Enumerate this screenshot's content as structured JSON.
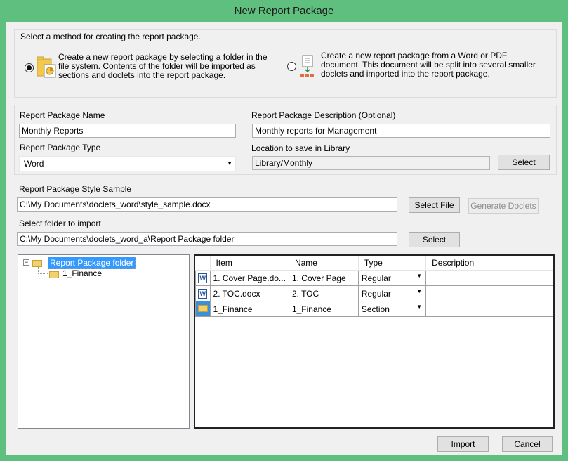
{
  "window": {
    "title": "New Report Package"
  },
  "method": {
    "legend": "Select a method for creating the report package.",
    "option_folder": "Create a new report package by selecting a folder in the file system. Contents of the folder will be imported as sections and doclets into the report package.",
    "option_document": "Create a new report package from a Word or PDF document. This document will be split into several smaller doclets and imported into the report package."
  },
  "package": {
    "name_label": "Report Package Name",
    "name_value": "Monthly Reports",
    "desc_label": "Report Package Description (Optional)",
    "desc_value": "Monthly reports for Management",
    "type_label": "Report Package Type",
    "type_value": "Word",
    "location_label": "Location to save in Library",
    "location_value": "Library/Monthly",
    "select_label": "Select"
  },
  "style": {
    "label": "Report Package Style Sample",
    "path": "C:\\My Documents\\doclets_word\\style_sample.docx",
    "select_file_label": "Select File",
    "generate_label": "Generate Doclets"
  },
  "import": {
    "label": "Select folder to import",
    "path": "C:\\My Documents\\doclets_word_a\\Report Package folder",
    "select_label": "Select"
  },
  "tree": {
    "root": "Report Package folder",
    "child": "1_Finance"
  },
  "grid": {
    "headers": {
      "item": "Item",
      "name": "Name",
      "type": "Type",
      "description": "Description"
    },
    "rows": [
      {
        "icon": "word-doc-icon",
        "item": "1. Cover Page.do...",
        "name": "1. Cover Page",
        "type": "Regular",
        "description": ""
      },
      {
        "icon": "word-doc-icon",
        "item": "2. TOC.docx",
        "name": "2. TOC",
        "type": "Regular",
        "description": ""
      },
      {
        "icon": "folder-icon",
        "item": "1_Finance",
        "name": "1_Finance",
        "type": "Section",
        "description": ""
      }
    ]
  },
  "footer": {
    "import_label": "Import",
    "cancel_label": "Cancel"
  },
  "colors": {
    "frame": "#5fbf7e",
    "selection": "#3399ff"
  }
}
